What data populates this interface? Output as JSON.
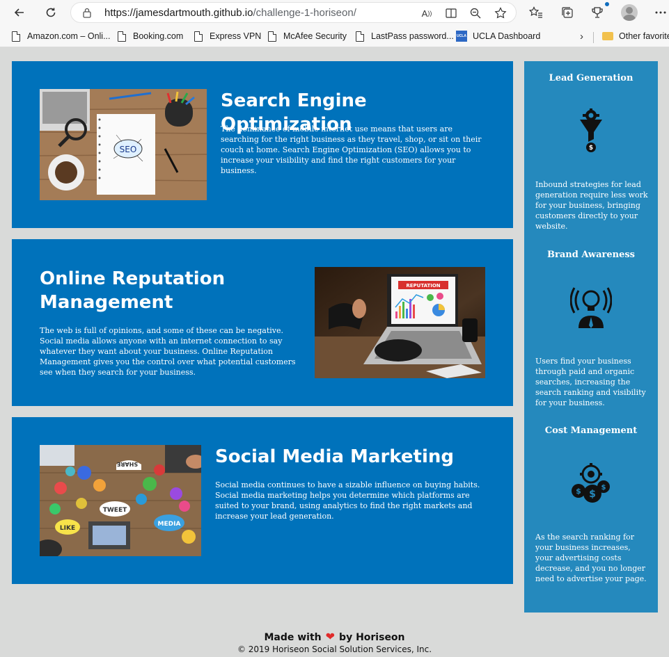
{
  "browser": {
    "url_host": "https://jamesdartmouth.github.io",
    "url_path": "/challenge-1-horiseon/",
    "read_aloud_label": "A",
    "bookmarks": [
      {
        "label": "Amazon.com – Onli..."
      },
      {
        "label": "Booking.com"
      },
      {
        "label": "Express VPN"
      },
      {
        "label": "McAfee Security"
      },
      {
        "label": "LastPass password..."
      },
      {
        "label": "UCLA Dashboard"
      },
      {
        "label": "Other favorite"
      }
    ],
    "ucla_badge": "UCLA"
  },
  "sections": [
    {
      "title": "Search Engine Optimization",
      "body": "The dominance of mobile internet use means that users are searching for the right business as they travel, shop, or sit on their couch at home. Search Engine Optimization (SEO) allows you to increase your visibility and find the right customers for your business."
    },
    {
      "title": "Online Reputation Management",
      "body": "The web is full of opinions, and some of these can be negative. Social media allows anyone with an internet connection to say whatever they want about your business. Online Reputation Management gives you the control over what potential customers see when they search for your business."
    },
    {
      "title": "Social Media Marketing",
      "body": "Social media continues to have a sizable influence on buying habits. Social media marketing helps you determine which platforms are suited to your brand, using analytics to find the right markets and increase your lead generation."
    }
  ],
  "image_text": {
    "seo": "SEO",
    "reputation": "REPUTATION",
    "tweet": "TWEET",
    "like": "LIKE",
    "media": "MEDIA",
    "share": "SHARE"
  },
  "benefits": [
    {
      "title": "Lead Generation",
      "body": "Inbound strategies for lead generation require less work for your business, bringing customers directly to your website."
    },
    {
      "title": "Brand Awareness",
      "body": "Users find your business through paid and organic searches, increasing the search ranking and visibility for your business."
    },
    {
      "title": "Cost Management",
      "body": "As the search ranking for your business increases, your advertising costs decrease, and you no longer need to advertise your page."
    }
  ],
  "footer": {
    "made_with": "Made with",
    "by": "by Horiseon",
    "copyright": "© 2019 Horiseon Social Solution Services, Inc."
  },
  "colors": {
    "panel_blue": "#0072bb",
    "sidebar_blue": "#2589bd",
    "page_bg": "#d9dad9",
    "heart": "#e02b2b"
  }
}
